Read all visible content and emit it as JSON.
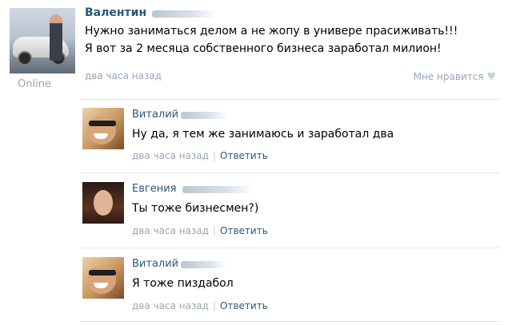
{
  "post": {
    "author": "Валентин",
    "status": "Online",
    "text_line1": "Нужно заниматься делом а не жопу в универе прасиживать!!!",
    "text_line2": "Я вот за 2 месяца собственного бизнеса заработал милион!",
    "time": "два часа назад",
    "like_label": "Мне нравится",
    "like_icon": "heart-icon"
  },
  "comments": [
    {
      "author": "Виталий",
      "text": "Ну да, я тем же занимаюсь и заработал два",
      "time": "два часа назад",
      "reply": "Ответить"
    },
    {
      "author": "Евгения",
      "text": "Ты тоже бизнесмен?)",
      "time": "два часа назад",
      "reply": "Ответить"
    },
    {
      "author": "Виталий",
      "text": "Я тоже пиздабол",
      "time": "два часа назад",
      "reply": "Ответить"
    }
  ]
}
